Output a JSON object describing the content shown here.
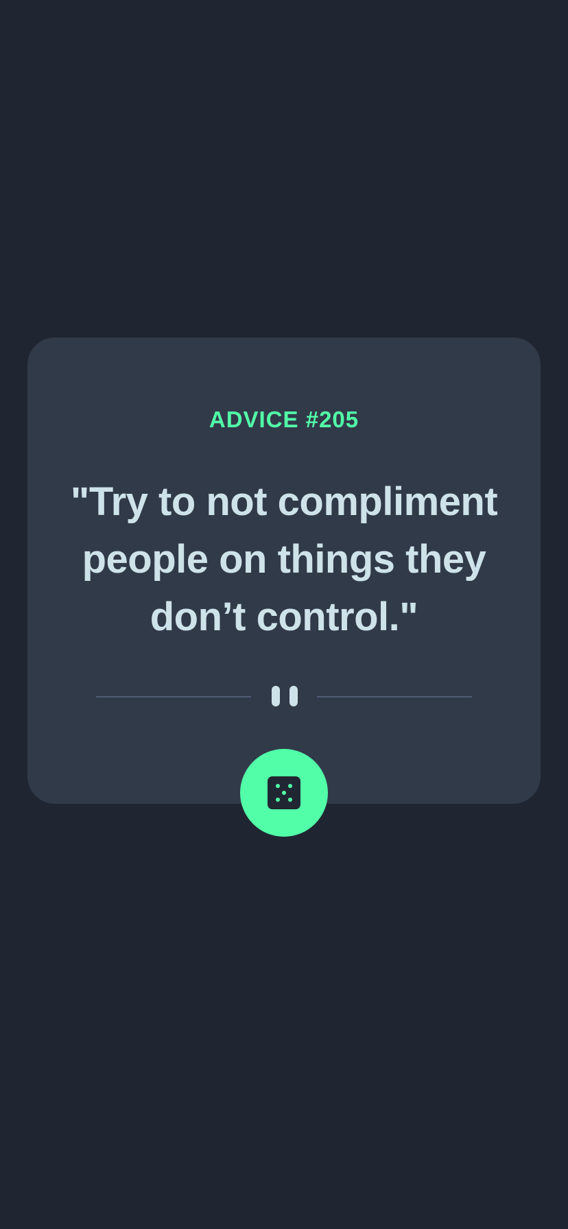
{
  "advice": {
    "id_label": "ADVICE #205",
    "quote": "\"Try to not compliment people on things they don’t control.\""
  },
  "icons": {
    "divider": "pause-divider-icon",
    "button": "dice-icon"
  },
  "colors": {
    "background": "#1f2632",
    "card": "#313a49",
    "accent": "#52ffa8",
    "text": "#cee3e9",
    "divider": "#4f5d74"
  }
}
